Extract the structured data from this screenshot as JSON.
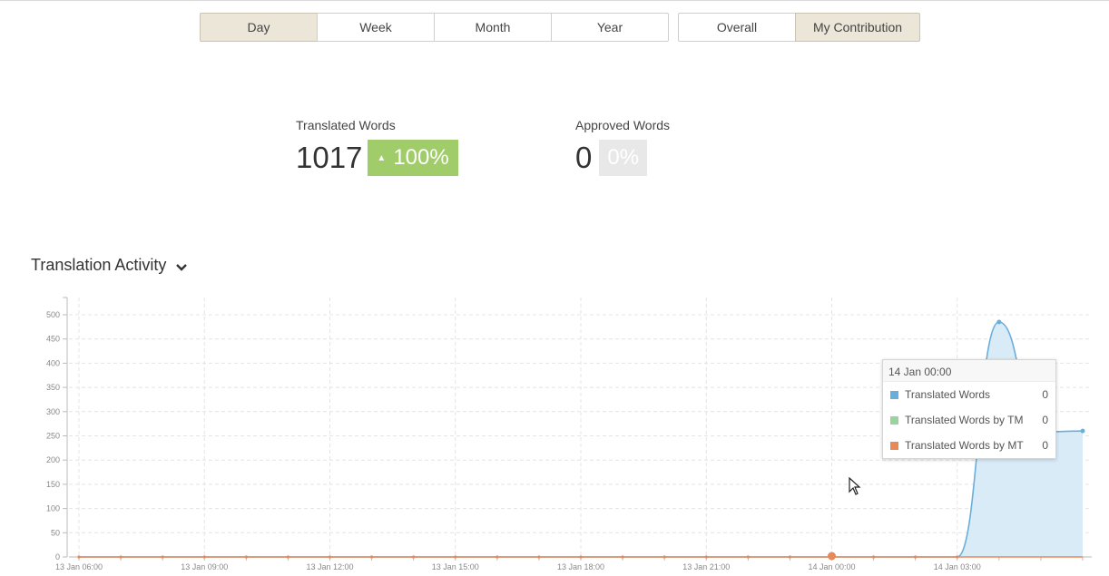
{
  "period_tabs": [
    {
      "label": "Day",
      "active": true
    },
    {
      "label": "Week",
      "active": false
    },
    {
      "label": "Month",
      "active": false
    },
    {
      "label": "Year",
      "active": false
    }
  ],
  "scope_tabs": [
    {
      "label": "Overall",
      "active": false
    },
    {
      "label": "My Contribution",
      "active": true
    }
  ],
  "stats": {
    "translated": {
      "label": "Translated Words",
      "value": "1017",
      "delta": "100%"
    },
    "approved": {
      "label": "Approved Words",
      "value": "0",
      "delta": "0%"
    }
  },
  "section": {
    "title": "Translation Activity",
    "icon": "chevron-down-icon"
  },
  "colors": {
    "translated": "#6aaedb",
    "translated_tm": "#99d4a0",
    "translated_mt": "#e8895a",
    "area_fill": "#d6e9f7",
    "active_tab": "#ebe6d8",
    "badge_green": "#a0cc6a"
  },
  "tooltip": {
    "title": "14 Jan 00:00",
    "items": [
      {
        "name": "Translated Words",
        "value": "0"
      },
      {
        "name": "Translated Words by TM",
        "value": "0"
      },
      {
        "name": "Translated Words by MT",
        "value": "0"
      }
    ]
  },
  "chart_data": {
    "type": "area",
    "xlabel": "",
    "ylabel": "",
    "ylim": [
      0,
      520
    ],
    "yticks": [
      0,
      50,
      100,
      150,
      200,
      250,
      300,
      350,
      400,
      450,
      500
    ],
    "x_tick_labels": [
      "13 Jan 06:00",
      "13 Jan 09:00",
      "13 Jan 12:00",
      "13 Jan 15:00",
      "13 Jan 18:00",
      "13 Jan 21:00",
      "14 Jan 00:00",
      "14 Jan 03:00"
    ],
    "grid": true,
    "series": [
      {
        "name": "Translated Words",
        "values": [
          0,
          0,
          0,
          0,
          0,
          0,
          0,
          0,
          0,
          0,
          0,
          0,
          0,
          0,
          0,
          0,
          0,
          0,
          0,
          0,
          0,
          0,
          485,
          258,
          260
        ]
      },
      {
        "name": "Translated Words by TM",
        "values": [
          0,
          0,
          0,
          0,
          0,
          0,
          0,
          0,
          0,
          0,
          0,
          0,
          0,
          0,
          0,
          0,
          0,
          0,
          0,
          0,
          0,
          0,
          0,
          0,
          0
        ]
      },
      {
        "name": "Translated Words by MT",
        "values": [
          0,
          0,
          0,
          0,
          0,
          0,
          0,
          0,
          0,
          0,
          0,
          0,
          0,
          0,
          0,
          0,
          0,
          0,
          0,
          0,
          0,
          0,
          0,
          0,
          0
        ]
      }
    ],
    "x_hours": [
      "06:00",
      "07:00",
      "08:00",
      "09:00",
      "10:00",
      "11:00",
      "12:00",
      "13:00",
      "14:00",
      "15:00",
      "16:00",
      "17:00",
      "18:00",
      "19:00",
      "20:00",
      "21:00",
      "22:00",
      "23:00",
      "00:00",
      "01:00",
      "02:00",
      "03:00",
      "04:00",
      "05:00",
      "06:00"
    ],
    "highlight_index": 18
  }
}
